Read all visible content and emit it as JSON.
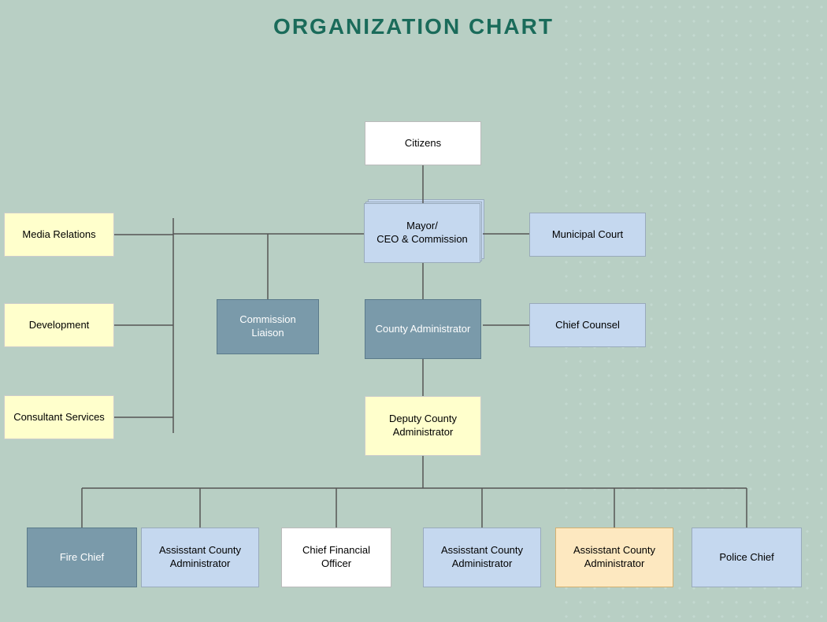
{
  "title": "ORGANIZATION CHART",
  "nodes": {
    "citizens": {
      "label": "Citizens"
    },
    "mayor": {
      "label": "Mayor/\nCEO & Commission"
    },
    "media": {
      "label": "Media Relations"
    },
    "development": {
      "label": "Development"
    },
    "consultant": {
      "label": "Consultant\nServices"
    },
    "comm_liaison": {
      "label": "Commission\nLiaison"
    },
    "county_admin": {
      "label": "County\nAdministrator"
    },
    "muni_court": {
      "label": "Municipal Court"
    },
    "chief_counsel": {
      "label": "Chief Counsel"
    },
    "deputy": {
      "label": "Deputy County\nAdministrator"
    },
    "fire": {
      "label": "Fire Chief"
    },
    "asst1": {
      "label": "Assisstant County\nAdministrator"
    },
    "cfo": {
      "label": "Chief Financial\nOfficer"
    },
    "asst2": {
      "label": "Assisstant County\nAdministrator"
    },
    "asst3": {
      "label": "Assisstant County\nAdministrator"
    },
    "police": {
      "label": "Police Chief"
    }
  }
}
